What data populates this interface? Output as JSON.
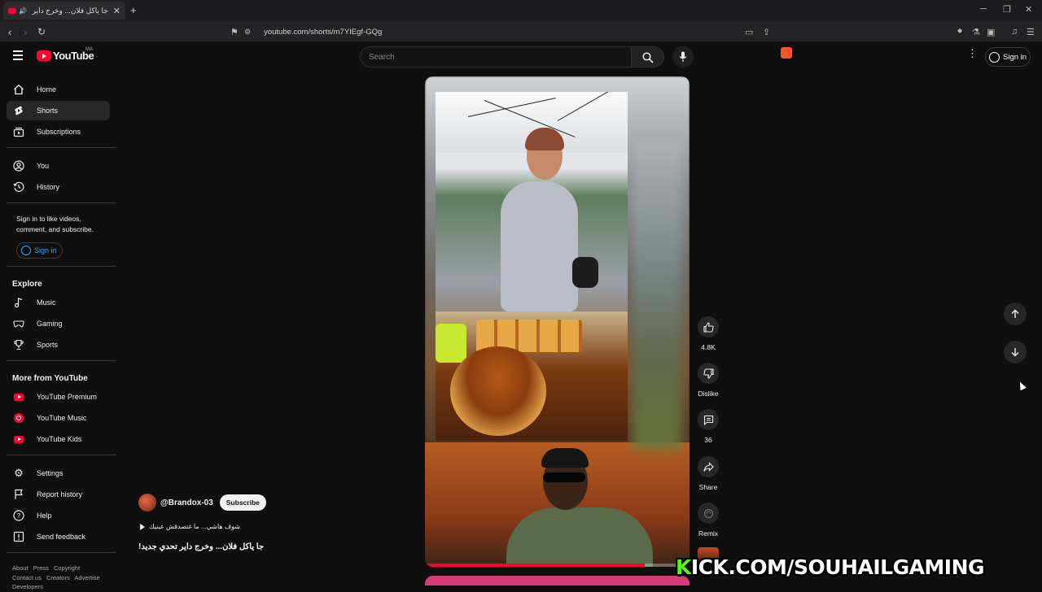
{
  "browser": {
    "tab_title": "جا ياكل فلان... وخرج داير تحدي",
    "url": "youtube.com/shorts/m7YIEgf-GQg"
  },
  "masthead": {
    "logo_text": "YouTube",
    "country_code": "MA",
    "search_placeholder": "Search",
    "signin_label": "Sign in"
  },
  "sidebar": {
    "primary": [
      {
        "label": "Home",
        "icon": "home-icon"
      },
      {
        "label": "Shorts",
        "icon": "shorts-icon",
        "active": true
      },
      {
        "label": "Subscriptions",
        "icon": "subscriptions-icon"
      }
    ],
    "you": [
      {
        "label": "You",
        "icon": "you-icon"
      },
      {
        "label": "History",
        "icon": "history-icon"
      }
    ],
    "signin_note": "Sign in to like videos, comment, and subscribe.",
    "signin_label": "Sign in",
    "explore_heading": "Explore",
    "explore": [
      {
        "label": "Music",
        "icon": "music-icon"
      },
      {
        "label": "Gaming",
        "icon": "gaming-icon"
      },
      {
        "label": "Sports",
        "icon": "trophy-icon"
      }
    ],
    "more_heading": "More from YouTube",
    "more": [
      {
        "label": "YouTube Premium",
        "icon": "youtube-premium-icon"
      },
      {
        "label": "YouTube Music",
        "icon": "youtube-music-icon"
      },
      {
        "label": "YouTube Kids",
        "icon": "youtube-kids-icon"
      }
    ],
    "settings": [
      {
        "label": "Settings",
        "icon": "gear-icon"
      },
      {
        "label": "Report history",
        "icon": "flag-icon"
      },
      {
        "label": "Help",
        "icon": "help-icon"
      },
      {
        "label": "Send feedback",
        "icon": "feedback-icon"
      }
    ],
    "footer_links": [
      "About",
      "Press",
      "Copyright",
      "Contact us",
      "Creators",
      "Advertise",
      "Developers"
    ]
  },
  "short": {
    "channel": "@Brandox-03",
    "subscribe_label": "Subscribe",
    "sound": "شوف هاشي... ما غتصدقش عينيك",
    "title": "جا ياكل فلان... وخرج داير تحدي جديد!",
    "progress": 0.83
  },
  "actions": {
    "like_count": "4.8K",
    "dislike_label": "Dislike",
    "comment_count": "36",
    "share_label": "Share",
    "remix_label": "Remix"
  },
  "watermark": {
    "prefix": "K",
    "rest": "ICK.COM/SOUHAILGAMING"
  },
  "colors": {
    "accent": "#ff0033",
    "link": "#3ea6ff",
    "kick_green": "#53fc18",
    "background": "#0f0f0f"
  }
}
